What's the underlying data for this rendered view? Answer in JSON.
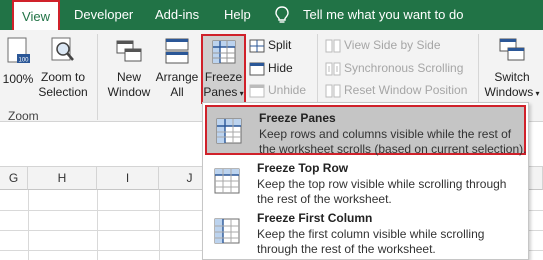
{
  "tabs": [
    "View",
    "Developer",
    "Add-ins",
    "Help"
  ],
  "tell_me": "Tell me what you want to do",
  "ribbon": {
    "zoom_100": "100%",
    "zoom_to_selection": [
      "Zoom to",
      "Selection"
    ],
    "zoom_group": "Zoom",
    "new_window": [
      "New",
      "Window"
    ],
    "arrange_all": [
      "Arrange",
      "All"
    ],
    "freeze_panes": [
      "Freeze",
      "Panes"
    ],
    "split": "Split",
    "hide": "Hide",
    "unhide": "Unhide",
    "view_side_by_side": "View Side by Side",
    "synchronous_scrolling": "Synchronous Scrolling",
    "reset_window_position": "Reset Window Position",
    "switch_windows": [
      "Switch",
      "Windows"
    ]
  },
  "columns": [
    "G",
    "H",
    "I",
    "J"
  ],
  "menu": [
    {
      "title": "Freeze Panes",
      "desc": "Keep rows and columns visible while the rest of the worksheet scrolls (based on current selection)."
    },
    {
      "title": "Freeze Top Row",
      "desc": "Keep the top row visible while scrolling through the rest of the worksheet."
    },
    {
      "title": "Freeze First Column",
      "desc": "Keep the first column visible while scrolling through the rest of the worksheet."
    }
  ],
  "colors": {
    "brand": "#217346",
    "highlight": "#d0212a"
  }
}
